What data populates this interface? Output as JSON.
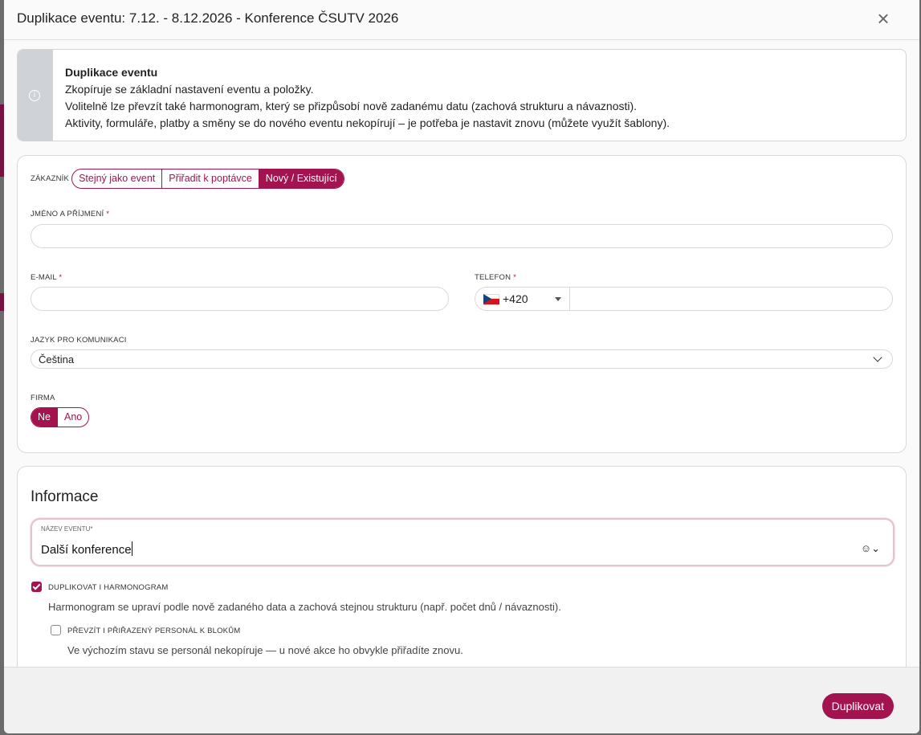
{
  "dialog": {
    "title": "Duplikace eventu: 7.12. - 8.12.2026 - Konference ČSUTV 2026",
    "close_icon": "×"
  },
  "info": {
    "icon": "info-icon",
    "heading": "Duplikace eventu",
    "lines": [
      "Zkopíruje se základní nastavení eventu a položky.",
      "Volitelně lze převzít také harmonogram, který se přizpůsobí nově zadanému datu (zachová strukturu a návaznosti).",
      "Aktivity, formuláře, platby a směny se do nového eventu nekopírují – je potřeba je nastavit znovu (můžete využít šablony)."
    ]
  },
  "customer": {
    "label": "ZÁKAZNÍK",
    "options": [
      "Stejný jako event",
      "Přiřadit k poptávce",
      "Nový / Existující"
    ],
    "selected": "Nový / Existující",
    "name_label": "JMÉNO A PŘÍJMENÍ",
    "name_value": "",
    "email_label": "E-MAIL",
    "email_value": "",
    "phone_label": "TELEFON",
    "phone_prefix": "+420",
    "phone_value": "",
    "language_label": "JAZYK PRO KOMUNIKACI",
    "language_value": "Čeština",
    "company_label": "FIRMA",
    "company_options": [
      "Ne",
      "Ano"
    ],
    "company_selected": "Ne",
    "required_mark": "*"
  },
  "information": {
    "section_title": "Informace",
    "event_name_label": "NÁZEV EVENTU",
    "event_name_value": "Další konference",
    "duplicate_schedule_label": "DUPLIKOVAT I HARMONOGRAM",
    "duplicate_schedule_checked": true,
    "duplicate_schedule_help": "Harmonogram se upraví podle nově zadaného data a zachová stejnou strukturu (např. počet dnů / návaznosti).",
    "copy_staff_label": "PŘEVZÍT I PŘIŘAZENÝ PERSONÁL K BLOKŮM",
    "copy_staff_checked": false,
    "copy_staff_help": "Ve výchozím stavu se personál nekopíruje — u nové akce ho obvykle přiřadíte znovu."
  },
  "footer": {
    "submit_label": "Duplikovat"
  },
  "colors": {
    "accent": "#a3134f",
    "info_stripe": "#cfd3d8"
  }
}
